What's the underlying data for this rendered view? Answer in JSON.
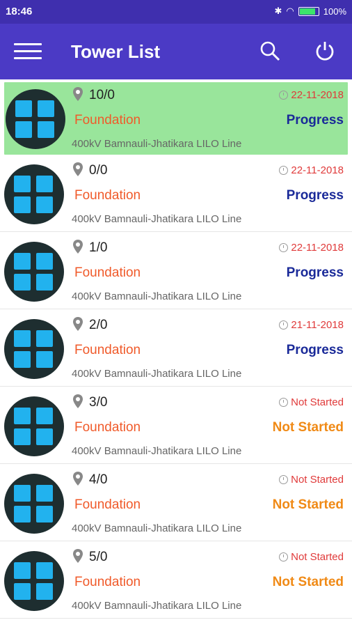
{
  "statusbar": {
    "time": "18:46",
    "battery": "100%"
  },
  "appbar": {
    "title": "Tower List"
  },
  "rows": [
    {
      "tower": "10/0",
      "activity": "Foundation",
      "line": "400kV Bamnauli-Jhatikara LILO Line",
      "date": "22-11-2018",
      "status": "Progress",
      "status_color": "#1a2a99",
      "selected": true
    },
    {
      "tower": "0/0",
      "activity": "Foundation",
      "line": "400kV Bamnauli-Jhatikara LILO Line",
      "date": "22-11-2018",
      "status": "Progress",
      "status_color": "#1a2a99"
    },
    {
      "tower": "1/0",
      "activity": "Foundation",
      "line": "400kV Bamnauli-Jhatikara LILO Line",
      "date": "22-11-2018",
      "status": "Progress",
      "status_color": "#1a2a99"
    },
    {
      "tower": "2/0",
      "activity": "Foundation",
      "line": "400kV Bamnauli-Jhatikara LILO Line",
      "date": "21-11-2018",
      "status": "Progress",
      "status_color": "#1a2a99"
    },
    {
      "tower": "3/0",
      "activity": "Foundation",
      "line": "400kV Bamnauli-Jhatikara LILO Line",
      "date": "Not Started",
      "status": "Not Started",
      "status_color": "#f08a16"
    },
    {
      "tower": "4/0",
      "activity": "Foundation",
      "line": "400kV Bamnauli-Jhatikara LILO Line",
      "date": "Not Started",
      "status": "Not Started",
      "status_color": "#f08a16"
    },
    {
      "tower": "5/0",
      "activity": "Foundation",
      "line": "400kV Bamnauli-Jhatikara LILO Line",
      "date": "Not Started",
      "status": "Not Started",
      "status_color": "#f08a16"
    }
  ],
  "colors": {
    "appbar": "#4b3ac5",
    "statusbar": "#3f2fae",
    "selected_row": "#99e59b",
    "activity": "#f05a2a",
    "date": "#e03a3a"
  }
}
